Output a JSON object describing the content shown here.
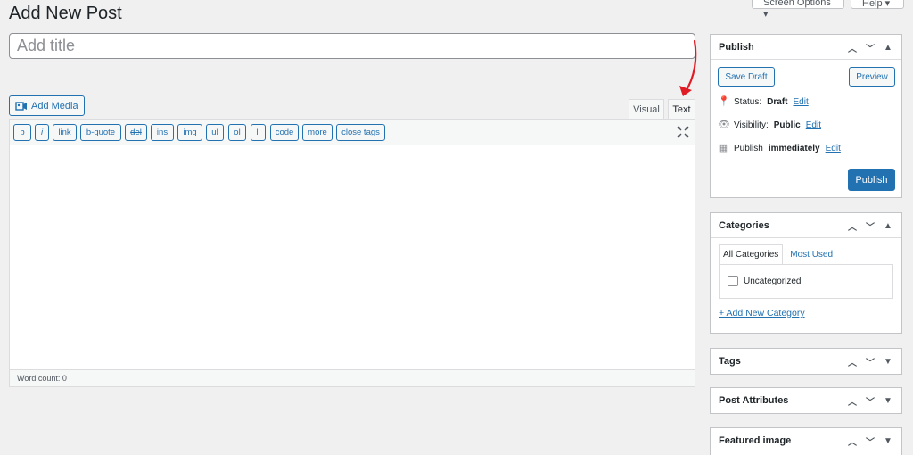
{
  "top": {
    "screen_options": "Screen Options ▾",
    "help": "Help ▾"
  },
  "page": {
    "title": "Add New Post"
  },
  "title_input": {
    "placeholder": "Add title",
    "value": ""
  },
  "editor": {
    "add_media": "Add Media",
    "tabs": {
      "visual": "Visual",
      "text": "Text"
    },
    "active_tab": "Text",
    "quicktags": [
      "b",
      "i",
      "link",
      "b-quote",
      "del",
      "ins",
      "img",
      "ul",
      "ol",
      "li",
      "code",
      "more",
      "close tags"
    ],
    "content": "",
    "word_count": "Word count: 0"
  },
  "publish": {
    "heading": "Publish",
    "save_draft": "Save Draft",
    "preview": "Preview",
    "status_label": "Status:",
    "status_value": "Draft",
    "visibility_label": "Visibility:",
    "visibility_value": "Public",
    "publish_label": "Publish",
    "publish_value": "immediately",
    "edit": "Edit",
    "publish_button": "Publish"
  },
  "categories": {
    "heading": "Categories",
    "tab_all": "All Categories",
    "tab_most_used": "Most Used",
    "items": [
      {
        "label": "Uncategorized",
        "checked": false
      }
    ],
    "add_new": "+ Add New Category"
  },
  "tags": {
    "heading": "Tags"
  },
  "post_attributes": {
    "heading": "Post Attributes"
  },
  "featured_image": {
    "heading": "Featured image"
  },
  "colors": {
    "accent": "#2271b1",
    "annotation_arrow": "#e01b24"
  }
}
